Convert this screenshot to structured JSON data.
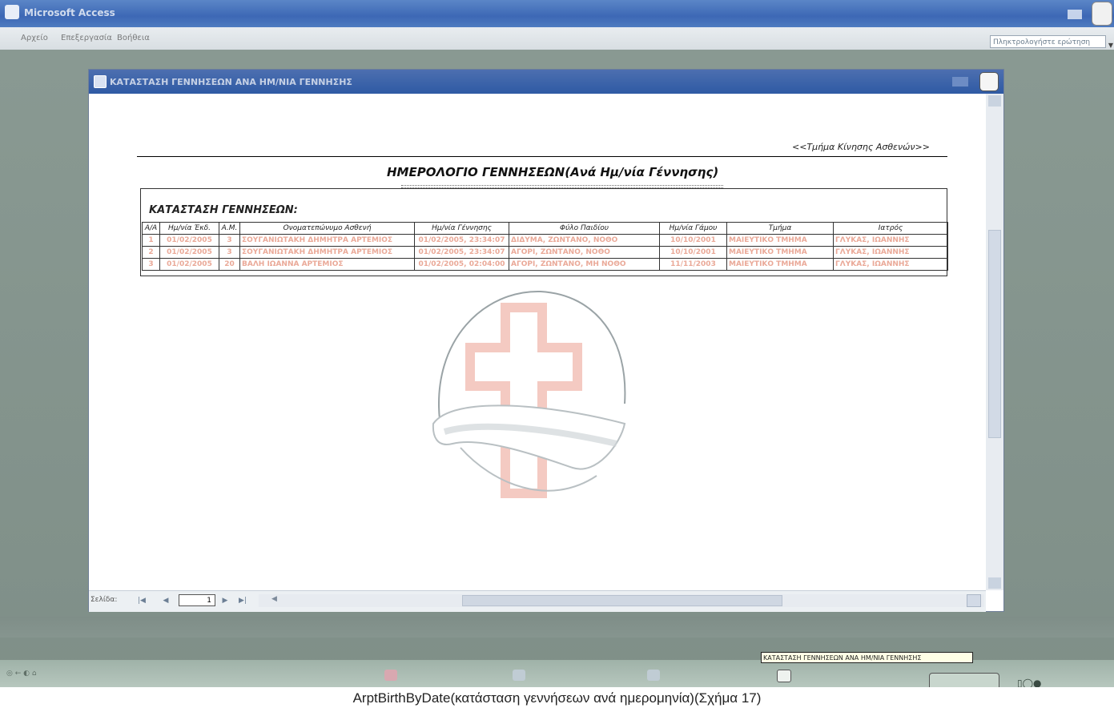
{
  "app": {
    "title": "Microsoft Access"
  },
  "menu": {
    "items": [
      "Αρχείο",
      "Επεξεργασία",
      "Βοήθεια"
    ]
  },
  "help_box": {
    "placeholder": "Πληκτρολογήστε ερώτηση"
  },
  "report_window": {
    "title": "ΚΑΤΑΣΤΑΣΗ ΓΕΝΝΗΣΕΩΝ ΑΝΑ ΗΜ/ΝΙΑ ΓΕΝΝΗΣΗΣ",
    "department_label": "<<Τμήμα Κίνησης Ασθενών>>",
    "report_title": "ΗΜΕΡΟΛΟΓΙΟ ΓΕΝΝΗΣΕΩΝ(Ανά Ημ/νία Γέννησης)",
    "section_title": "ΚΑΤΑΣΤΑΣΗ ΓΕΝΝΗΣΕΩΝ:",
    "columns": [
      "Α/Α",
      "Ημ/νία Έκδ.",
      "Α.Μ.",
      "Ονοματεπώνυμο Ασθενή",
      "Ημ/νία Γέννησης",
      "Φύλο Παιδίου",
      "Ημ/νία Γάμου",
      "Τμήμα",
      "Ιατρός"
    ],
    "rows": [
      [
        "1",
        "01/02/2005",
        "3",
        "ΣΟΥΓΑΝΙΩΤΑΚΗ ΔΗΜΗΤΡΑ ΑΡΤΕΜΙΟΣ",
        "01/02/2005, 23:34:07",
        "ΔΙΔΥΜΑ, ΖΩΝΤΑΝΟ, ΝΟΘΟ",
        "10/10/2001",
        "ΜΑΙΕΥΤΙΚΟ ΤΜΗΜΑ",
        "ΓΛΥΚΑΣ, ΙΩΑΝΝΗΣ"
      ],
      [
        "2",
        "01/02/2005",
        "3",
        "ΣΟΥΓΑΝΙΩΤΑΚΗ ΔΗΜΗΤΡΑ ΑΡΤΕΜΙΟΣ",
        "01/02/2005, 23:34:07",
        "ΑΓΟΡΙ, ΖΩΝΤΑΝΟ, ΝΟΘΟ",
        "10/10/2001",
        "ΜΑΙΕΥΤΙΚΟ ΤΜΗΜΑ",
        "ΓΛΥΚΑΣ, ΙΩΑΝΝΗΣ"
      ],
      [
        "3",
        "01/02/2005",
        "20",
        "ΒΑΛΗ ΙΩΑΝΝΑ ΑΡΤΕΜΙΟΣ",
        "01/02/2005, 02:04:00",
        "ΑΓΟΡΙ, ΖΩΝΤΑΝΟ, ΜΗ ΝΟΘΟ",
        "11/11/2003",
        "ΜΑΙΕΥΤΙΚΟ ΤΜΗΜΑ",
        "ΓΛΥΚΑΣ, ΙΩΑΝΝΗΣ"
      ]
    ],
    "nav": {
      "page_label": "Σελίδα:",
      "page_value": "1",
      "first": "|◀",
      "prev": "◀",
      "next": "▶",
      "last": "▶|"
    }
  },
  "tooltip": "ΚΑΤΑΣΤΑΣΗ ΓΕΝΝΗΣΕΩΝ ΑΝΑ ΗΜ/ΝΙΑ ΓΕΝΝΗΣΗΣ",
  "caption": "ArptBirthByDate(κατάσταση γεννήσεων ανά ημερομηνία)(Σχήμα 17)",
  "colors": {
    "row_text": "#eaa998",
    "title_bar": "#3d68b5",
    "desktop": "#8a9a93",
    "logo_cross": "#f0b8ad"
  }
}
